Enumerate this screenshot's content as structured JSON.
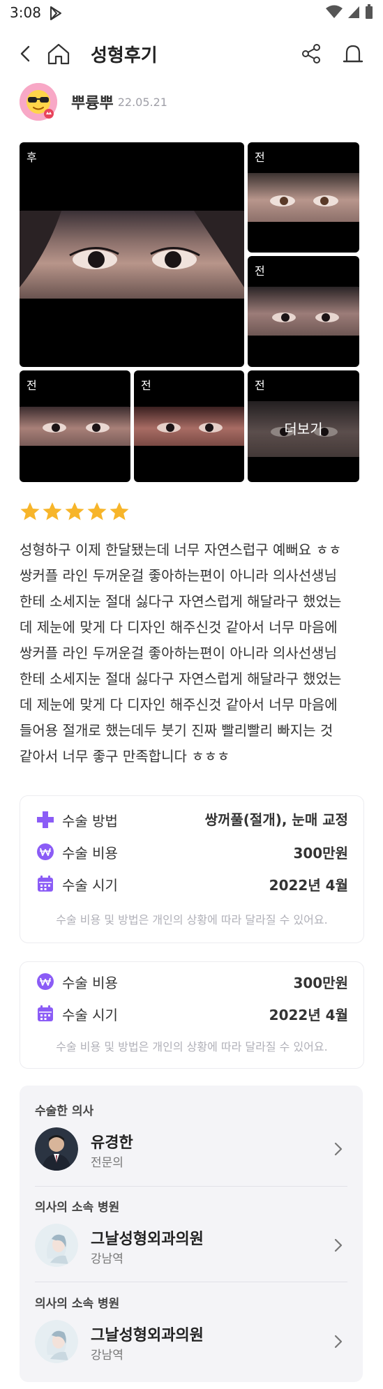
{
  "status_bar": {
    "time": "3:08"
  },
  "header": {
    "title": "성형후기"
  },
  "author": {
    "name": "뿌륭뿌",
    "date": "22.05.21"
  },
  "photos": {
    "main_tag": "후",
    "before_tag": "전",
    "more_label": "더보기"
  },
  "rating": {
    "stars": 5,
    "max": 5
  },
  "review": {
    "lines": [
      "성형하구 이제 한달됐는데 너무 자연스럽구 예뻐요 ㅎㅎ",
      "쌍커플 라인 두꺼운걸 좋아하는편이 아니라 의사선생님",
      "한테 소세지눈 절대 싫다구 자연스럽게 해달라구 했었는",
      "데 제눈에 맞게 다 디자인 해주신것 같아서 너무 마음에",
      "쌍커플 라인 두꺼운걸 좋아하는편이 아니라 의사선생님",
      "한테 소세지눈 절대 싫다구 자연스럽게 해달라구 했었는",
      "데 제눈에 맞게 다 디자인 해주신것 같아서 너무 마음에",
      "들어용 절개로 했는데두 붓기 진짜 빨리빨리 빠지는 것",
      "같아서 너무 좋구 만족합니다 ㅎㅎㅎ"
    ]
  },
  "info_card": {
    "method_label": "수술 방법",
    "method_value": "쌍꺼풀(절개), 눈매 교정",
    "cost_label": "수술 비용",
    "cost_value": "300만원",
    "time_label": "수술 시기",
    "time_value": "2022년 4월",
    "note": "수술 비용 및 방법은 개인의 상황에 따라 달라질 수 있어요."
  },
  "info_card_2": {
    "cost_label": "수술 비용",
    "cost_value": "300만원",
    "time_label": "수술 시기",
    "time_value": "2022년 4월",
    "note": "수술 비용 및 방법은 개인의 상황에 따라 달라질 수 있어요."
  },
  "doctor_section": {
    "doctor_heading": "수술한 의사",
    "doctor_name": "유경한",
    "doctor_title": "전문의",
    "hospital_heading": "의사의 소속 병원",
    "hospital_name": "그날성형외과의원",
    "hospital_location": "강남역",
    "hospital_heading_2": "의사의 소속 병원",
    "hospital_name_2": "그날성형외과의원",
    "hospital_location_2": "강남역"
  },
  "colors": {
    "accent": "#8b5cf6",
    "star": "#f7b52a",
    "photo_bg": "#000000",
    "doctor_box_bg": "#f4f4f7"
  },
  "icons": {
    "back": "chevron-left-icon",
    "home": "home-icon",
    "share": "share-icon",
    "report": "siren-icon",
    "method": "plus-icon",
    "cost": "won-icon",
    "time": "calendar-icon",
    "chevron": "chevron-right-icon"
  }
}
